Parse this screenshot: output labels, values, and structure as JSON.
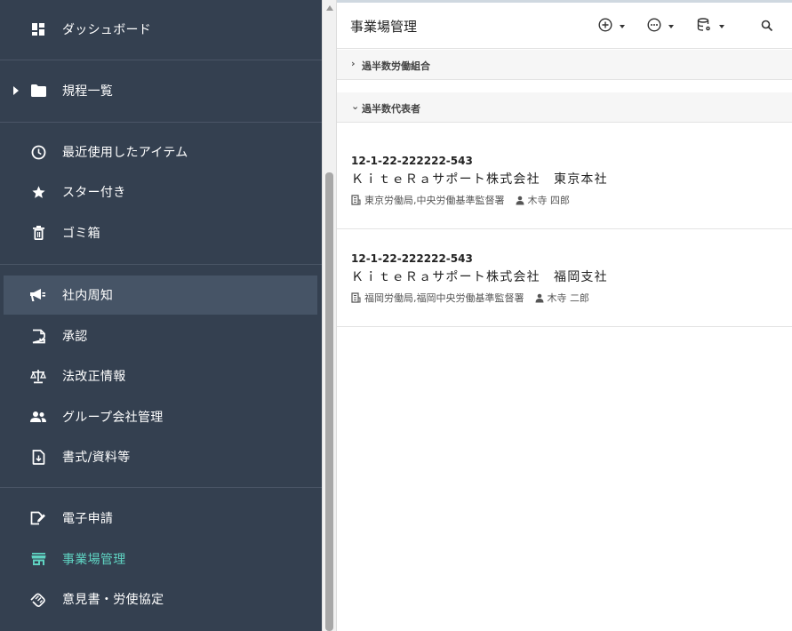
{
  "sidebar": {
    "items": [
      {
        "label": "ダッシュボード",
        "icon": "dashboard-icon"
      },
      {
        "label": "規程一覧",
        "icon": "folder-icon"
      },
      {
        "label": "最近使用したアイテム",
        "icon": "clock-icon"
      },
      {
        "label": "スター付き",
        "icon": "star-icon"
      },
      {
        "label": "ゴミ箱",
        "icon": "trash-icon"
      },
      {
        "label": "社内周知",
        "icon": "megaphone-icon"
      },
      {
        "label": "承認",
        "icon": "approval-icon"
      },
      {
        "label": "法改正情報",
        "icon": "scale-icon"
      },
      {
        "label": "グループ会社管理",
        "icon": "group-icon"
      },
      {
        "label": "書式/資料等",
        "icon": "document-download-icon"
      },
      {
        "label": "電子申請",
        "icon": "e-application-icon"
      },
      {
        "label": "事業場管理",
        "icon": "store-icon"
      },
      {
        "label": "意見書・労使協定",
        "icon": "agreement-icon"
      }
    ],
    "selected_color": "#5fd3c2"
  },
  "main": {
    "title": "事業場管理",
    "groups": [
      {
        "chevron": "›",
        "label": "過半数労働組合"
      },
      {
        "chevron": "⌄",
        "label": "過半数代表者"
      }
    ],
    "cards": [
      {
        "code": "12-1-22-222222-543",
        "name": "ＫｉｔｅＲａサポート株式会社　東京本社",
        "office": "東京労働局,中央労働基準監督署",
        "person": "木寺 四郎"
      },
      {
        "code": "12-1-22-222222-543",
        "name": "ＫｉｔｅＲａサポート株式会社　福岡支社",
        "office": "福岡労働局,福岡中央労働基準監督署",
        "person": "木寺 二郎"
      }
    ]
  }
}
